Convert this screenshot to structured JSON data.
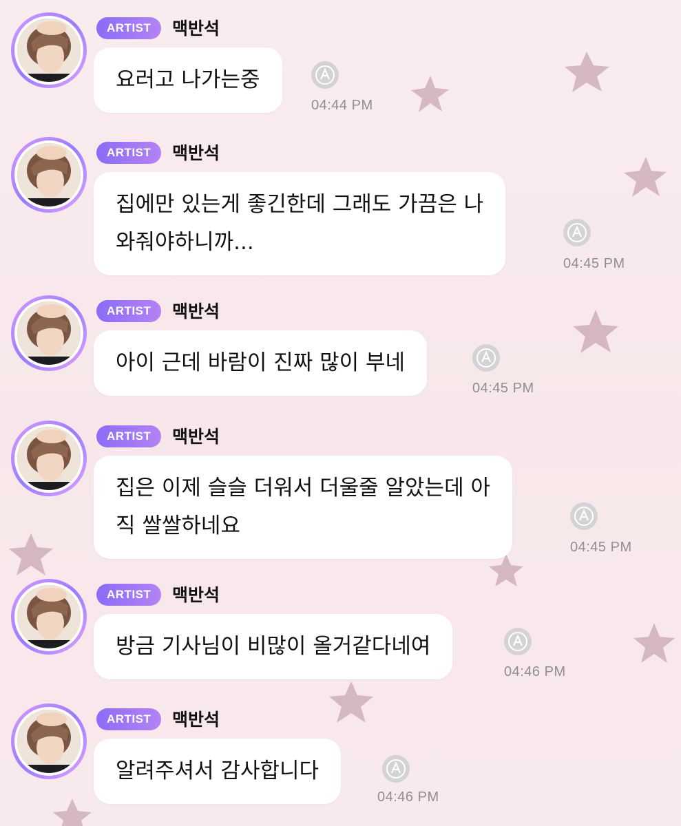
{
  "colors": {
    "badge_gradient_start": "#8b6cf6",
    "badge_gradient_end": "#b483f5",
    "avatar_ring": "#b08cff",
    "bubble": "#ffffff",
    "time_text": "#8e8e93",
    "star": "#c9a7b5"
  },
  "messages": [
    {
      "badge": "ARTIST",
      "sender": "맥반석",
      "text": "요러고 나가는중",
      "time": "04:44 PM",
      "translate_icon": "translate-icon"
    },
    {
      "badge": "ARTIST",
      "sender": "맥반석",
      "text": "집에만 있는게 좋긴한데 그래도 가끔은 나\n와줘야하니까...",
      "time": "04:45 PM",
      "translate_icon": "translate-icon"
    },
    {
      "badge": "ARTIST",
      "sender": "맥반석",
      "text": "아이 근데 바람이 진짜 많이 부네",
      "time": "04:45 PM",
      "translate_icon": "translate-icon"
    },
    {
      "badge": "ARTIST",
      "sender": "맥반석",
      "text": "집은 이제 슬슬 더워서 더울줄 알았는데 아\n직 쌀쌀하네요",
      "time": "04:45 PM",
      "translate_icon": "translate-icon"
    },
    {
      "badge": "ARTIST",
      "sender": "맥반석",
      "text": "방금 기사님이 비많이 올거같다네여",
      "time": "04:46 PM",
      "translate_icon": "translate-icon"
    },
    {
      "badge": "ARTIST",
      "sender": "맥반석",
      "text": "알려주셔서 감사합니다",
      "time": "04:46 PM",
      "translate_icon": "translate-icon"
    }
  ]
}
